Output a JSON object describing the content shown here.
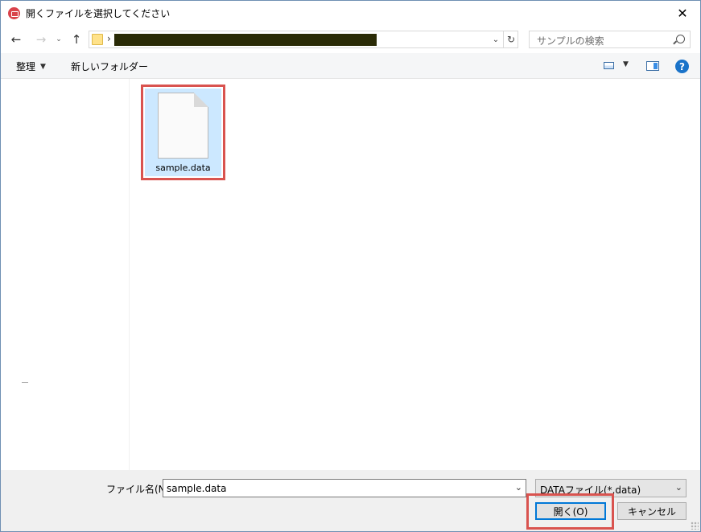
{
  "window": {
    "title": "開くファイルを選択してください",
    "close_glyph": "✕"
  },
  "nav": {
    "back_glyph": "←",
    "forward_glyph": "→",
    "recent_glyph": "⌄",
    "up_glyph": "↑",
    "crumb_separator": "›",
    "address_dropdown_glyph": "⌄",
    "refresh_glyph": "↻"
  },
  "search": {
    "placeholder": "サンプルの検索"
  },
  "toolbar": {
    "organize_label": "整理",
    "organize_caret": "▼",
    "new_folder_label": "新しいフォルダー",
    "view_caret": "▼",
    "help_glyph": "?"
  },
  "files": [
    {
      "name": "sample.data",
      "selected": true
    }
  ],
  "bottom": {
    "filename_label": "ファイル名(N):",
    "filename_value": "sample.data",
    "filename_caret": "⌄",
    "filetype_value": "DATAファイル(*.data)",
    "filetype_caret": "⌄",
    "open_label": "開く(O)",
    "cancel_label": "キャンセル"
  },
  "colors": {
    "highlight_box": "#d9534f",
    "selection": "#cce8ff",
    "accent": "#0078d7"
  }
}
